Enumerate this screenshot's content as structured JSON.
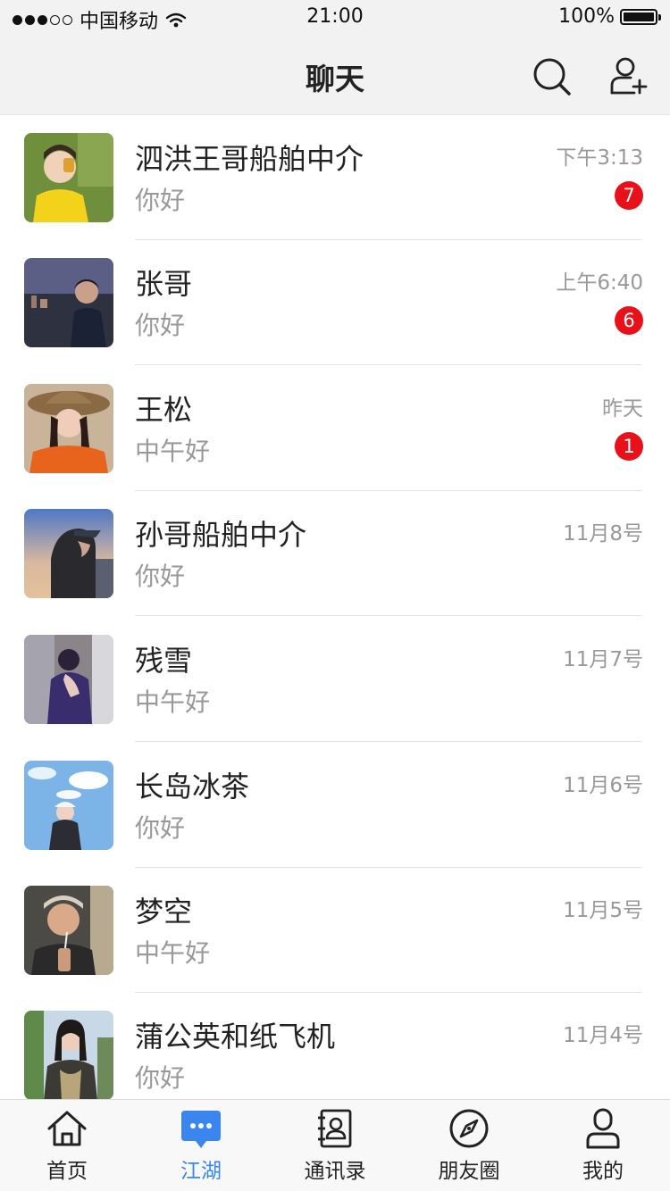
{
  "status_bar": {
    "carrier": "中国移动",
    "time": "21:00",
    "battery": "100%"
  },
  "header": {
    "title": "聊天",
    "search_icon": "search-icon",
    "add_user_icon": "add-user-icon"
  },
  "chats": [
    {
      "name": "泗洪王哥船舶中介",
      "message": "你好",
      "time": "下午3:13",
      "unread": "7"
    },
    {
      "name": "张哥",
      "message": "你好",
      "time": "上午6:40",
      "unread": "6"
    },
    {
      "name": "王松",
      "message": "中午好",
      "time": "昨天",
      "unread": "1"
    },
    {
      "name": "孙哥船舶中介",
      "message": "你好",
      "time": "11月8号",
      "unread": ""
    },
    {
      "name": "残雪",
      "message": "中午好",
      "time": "11月7号",
      "unread": ""
    },
    {
      "name": "长岛冰茶",
      "message": "你好",
      "time": "11月6号",
      "unread": ""
    },
    {
      "name": "梦空",
      "message": "中午好",
      "time": "11月5号",
      "unread": ""
    },
    {
      "name": "蒲公英和纸飞机",
      "message": "你好",
      "time": "11月4号",
      "unread": ""
    }
  ],
  "tabs": [
    {
      "label": "首页",
      "icon": "home-icon",
      "active": false
    },
    {
      "label": "江湖",
      "icon": "chat-bubble-icon",
      "active": true
    },
    {
      "label": "通讯录",
      "icon": "contacts-icon",
      "active": false
    },
    {
      "label": "朋友圈",
      "icon": "compass-icon",
      "active": false
    },
    {
      "label": "我的",
      "icon": "profile-icon",
      "active": false
    }
  ],
  "colors": {
    "accent": "#3b85ee",
    "badge": "#e8111a",
    "header_bg": "#f2f2f2"
  }
}
